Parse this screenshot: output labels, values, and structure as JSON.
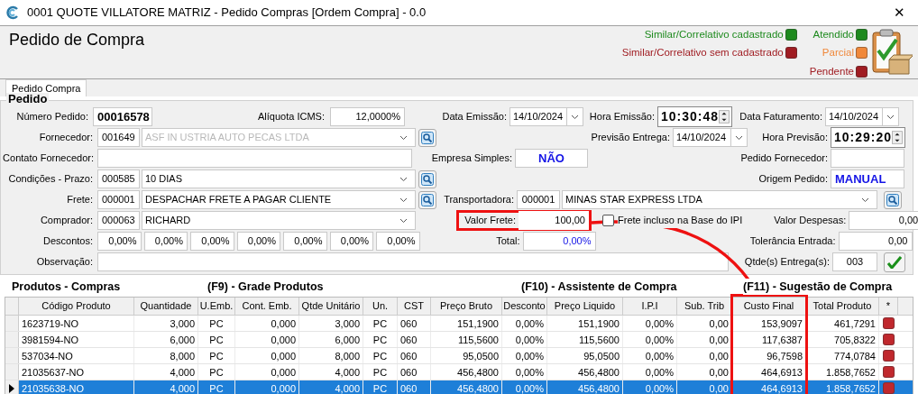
{
  "window": {
    "title": "0001 QUOTE VILLATORE MATRIZ - Pedido Compras [Ordem Compra] - 0.0",
    "close": "✕"
  },
  "header": {
    "title": "Pedido de Compra",
    "legend": [
      {
        "label": "Similar/Correlativo cadastrado",
        "color": "#1e8a1e"
      },
      {
        "label": "Similar/Correlativo sem cadastrado",
        "color": "#a01c22"
      }
    ],
    "status_legend": [
      {
        "label": "Atendido",
        "color": "#1e8a1e"
      },
      {
        "label": "Parcial",
        "color": "#f0883a"
      },
      {
        "label": "Pendente",
        "color": "#a01c22"
      }
    ]
  },
  "tabs": [
    {
      "label": "Pedido Compra",
      "selected": true
    }
  ],
  "pedido": {
    "title": "Pedido",
    "numero_pedido": {
      "label": "Número Pedido:",
      "value": "00016578"
    },
    "aliquota_icms": {
      "label": "Alíquota ICMS:",
      "value": "12,0000%"
    },
    "data_emissao": {
      "label": "Data Emissão:",
      "value": "14/10/2024"
    },
    "hora_emissao": {
      "label": "Hora Emissão:",
      "value": "10:30:48"
    },
    "data_faturamento": {
      "label": "Data Faturamento:",
      "value": "14/10/2024"
    },
    "fornecedor": {
      "label": "Fornecedor:",
      "code": "001649",
      "name": "ASF IN USTRIA AUTO PECAS LTDA",
      "disabled": true
    },
    "previsao_entrega": {
      "label": "Previsão Entrega:",
      "value": "14/10/2024"
    },
    "hora_previsao": {
      "label": "Hora Previsão:",
      "value": "10:29:20"
    },
    "contato_fornecedor": {
      "label": "Contato Fornecedor:"
    },
    "empresa_simples": {
      "label": "Empresa Simples:",
      "value": "NÃO"
    },
    "pedido_fornecedor": {
      "label": "Pedido Fornecedor:"
    },
    "condicoes_prazo": {
      "label": "Condições - Prazo:",
      "code": "000585",
      "name": "10 DIAS",
      "disabled": false
    },
    "origem_pedido": {
      "label": "Origem Pedido:",
      "value": "MANUAL"
    },
    "frete": {
      "label": "Frete:",
      "code": "000001",
      "name": "DESPACHAR FRETE A PAGAR CLIENTE",
      "disabled": false
    },
    "transportadora": {
      "label": "Transportadora:",
      "code": "000001",
      "name": "MINAS STAR EXPRESS LTDA",
      "disabled": false
    },
    "comprador": {
      "label": "Comprador:",
      "code": "000063",
      "name": "RICHARD",
      "disabled": false
    },
    "valor_frete": {
      "label": "Valor Frete:",
      "value": "100,00",
      "highlighted": true
    },
    "frete_incluso_ipi": {
      "label": "Frete incluso na Base do IPI",
      "checked": false
    },
    "valor_despesas": {
      "label": "Valor Despesas:",
      "value": "0,00"
    },
    "descontos": {
      "label": "Descontos:",
      "values": [
        "0,00%",
        "0,00%",
        "0,00%",
        "0,00%",
        "0,00%",
        "0,00%",
        "0,00%"
      ]
    },
    "total": {
      "label": "Total:",
      "value": "0,00%"
    },
    "tolerancia_entrada": {
      "label": "Tolerância Entrada:",
      "value": "0,00"
    },
    "observacao": {
      "label": "Observação:"
    },
    "qtde_entregas": {
      "label": "Qtde(s) Entrega(s):",
      "value": "003"
    }
  },
  "produtos": {
    "title": "Produtos - Compras",
    "shortcuts": [
      "(F9) - Grade Produtos",
      "(F10) - Assistente de Compra",
      "(F11) - Sugestão de Compra"
    ],
    "columns": [
      {
        "label": "Código Produto",
        "highlighted": false
      },
      {
        "label": "Quantidade",
        "highlighted": false
      },
      {
        "label": "U.Emb.",
        "highlighted": false
      },
      {
        "label": "Cont. Emb.",
        "highlighted": false
      },
      {
        "label": "Qtde Unitário",
        "highlighted": false
      },
      {
        "label": "Un.",
        "highlighted": false
      },
      {
        "label": "CST",
        "highlighted": false
      },
      {
        "label": "Preço Bruto",
        "highlighted": false
      },
      {
        "label": "Desconto",
        "highlighted": false
      },
      {
        "label": "Preço Liquido",
        "highlighted": false
      },
      {
        "label": "I.P.I",
        "highlighted": false
      },
      {
        "label": "Sub. Trib",
        "highlighted": false
      },
      {
        "label": "Custo Final",
        "highlighted": true
      },
      {
        "label": "Total Produto",
        "highlighted": false
      },
      {
        "label": "*",
        "highlighted": false
      }
    ],
    "rows": [
      {
        "cells": [
          "1623719-NO",
          "3,000",
          "PC",
          "0,000",
          "3,000",
          "PC",
          "060",
          "151,1900",
          "0,00%",
          "151,1900",
          "0,00%",
          "0,00",
          "153,9097",
          "461,7291"
        ],
        "selected": false
      },
      {
        "cells": [
          "3981594-NO",
          "6,000",
          "PC",
          "0,000",
          "6,000",
          "PC",
          "060",
          "115,5600",
          "0,00%",
          "115,5600",
          "0,00%",
          "0,00",
          "117,6387",
          "705,8322"
        ],
        "selected": false
      },
      {
        "cells": [
          "537034-NO",
          "8,000",
          "PC",
          "0,000",
          "8,000",
          "PC",
          "060",
          "95,0500",
          "0,00%",
          "95,0500",
          "0,00%",
          "0,00",
          "96,7598",
          "774,0784"
        ],
        "selected": false
      },
      {
        "cells": [
          "21035637-NO",
          "4,000",
          "PC",
          "0,000",
          "4,000",
          "PC",
          "060",
          "456,4800",
          "0,00%",
          "456,4800",
          "0,00%",
          "0,00",
          "464,6913",
          "1.858,7652"
        ],
        "selected": false
      },
      {
        "cells": [
          "21035638-NO",
          "4,000",
          "PC",
          "0,000",
          "4,000",
          "PC",
          "060",
          "456,4800",
          "0,00%",
          "456,4800",
          "0,00%",
          "0,00",
          "464,6913",
          "1.858,7652"
        ],
        "selected": true
      }
    ]
  }
}
